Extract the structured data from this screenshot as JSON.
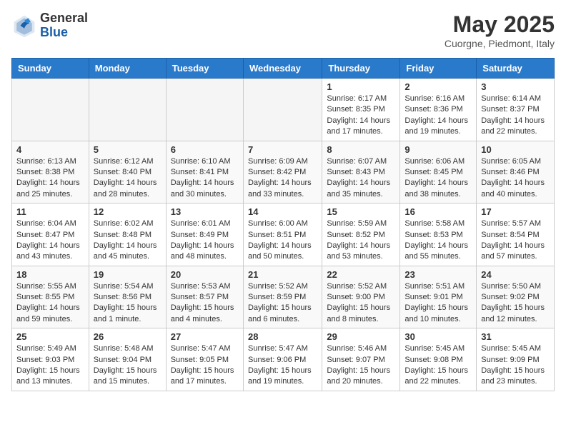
{
  "header": {
    "logo_general": "General",
    "logo_blue": "Blue",
    "month_title": "May 2025",
    "location": "Cuorgne, Piedmont, Italy"
  },
  "calendar": {
    "days_of_week": [
      "Sunday",
      "Monday",
      "Tuesday",
      "Wednesday",
      "Thursday",
      "Friday",
      "Saturday"
    ],
    "weeks": [
      [
        {
          "day": "",
          "empty": true
        },
        {
          "day": "",
          "empty": true
        },
        {
          "day": "",
          "empty": true
        },
        {
          "day": "",
          "empty": true
        },
        {
          "day": "1",
          "sunrise": "6:17 AM",
          "sunset": "8:35 PM",
          "daylight": "14 hours and 17 minutes."
        },
        {
          "day": "2",
          "sunrise": "6:16 AM",
          "sunset": "8:36 PM",
          "daylight": "14 hours and 19 minutes."
        },
        {
          "day": "3",
          "sunrise": "6:14 AM",
          "sunset": "8:37 PM",
          "daylight": "14 hours and 22 minutes."
        }
      ],
      [
        {
          "day": "4",
          "sunrise": "6:13 AM",
          "sunset": "8:38 PM",
          "daylight": "14 hours and 25 minutes."
        },
        {
          "day": "5",
          "sunrise": "6:12 AM",
          "sunset": "8:40 PM",
          "daylight": "14 hours and 28 minutes."
        },
        {
          "day": "6",
          "sunrise": "6:10 AM",
          "sunset": "8:41 PM",
          "daylight": "14 hours and 30 minutes."
        },
        {
          "day": "7",
          "sunrise": "6:09 AM",
          "sunset": "8:42 PM",
          "daylight": "14 hours and 33 minutes."
        },
        {
          "day": "8",
          "sunrise": "6:07 AM",
          "sunset": "8:43 PM",
          "daylight": "14 hours and 35 minutes."
        },
        {
          "day": "9",
          "sunrise": "6:06 AM",
          "sunset": "8:45 PM",
          "daylight": "14 hours and 38 minutes."
        },
        {
          "day": "10",
          "sunrise": "6:05 AM",
          "sunset": "8:46 PM",
          "daylight": "14 hours and 40 minutes."
        }
      ],
      [
        {
          "day": "11",
          "sunrise": "6:04 AM",
          "sunset": "8:47 PM",
          "daylight": "14 hours and 43 minutes."
        },
        {
          "day": "12",
          "sunrise": "6:02 AM",
          "sunset": "8:48 PM",
          "daylight": "14 hours and 45 minutes."
        },
        {
          "day": "13",
          "sunrise": "6:01 AM",
          "sunset": "8:49 PM",
          "daylight": "14 hours and 48 minutes."
        },
        {
          "day": "14",
          "sunrise": "6:00 AM",
          "sunset": "8:51 PM",
          "daylight": "14 hours and 50 minutes."
        },
        {
          "day": "15",
          "sunrise": "5:59 AM",
          "sunset": "8:52 PM",
          "daylight": "14 hours and 53 minutes."
        },
        {
          "day": "16",
          "sunrise": "5:58 AM",
          "sunset": "8:53 PM",
          "daylight": "14 hours and 55 minutes."
        },
        {
          "day": "17",
          "sunrise": "5:57 AM",
          "sunset": "8:54 PM",
          "daylight": "14 hours and 57 minutes."
        }
      ],
      [
        {
          "day": "18",
          "sunrise": "5:55 AM",
          "sunset": "8:55 PM",
          "daylight": "14 hours and 59 minutes."
        },
        {
          "day": "19",
          "sunrise": "5:54 AM",
          "sunset": "8:56 PM",
          "daylight": "15 hours and 1 minute."
        },
        {
          "day": "20",
          "sunrise": "5:53 AM",
          "sunset": "8:57 PM",
          "daylight": "15 hours and 4 minutes."
        },
        {
          "day": "21",
          "sunrise": "5:52 AM",
          "sunset": "8:59 PM",
          "daylight": "15 hours and 6 minutes."
        },
        {
          "day": "22",
          "sunrise": "5:52 AM",
          "sunset": "9:00 PM",
          "daylight": "15 hours and 8 minutes."
        },
        {
          "day": "23",
          "sunrise": "5:51 AM",
          "sunset": "9:01 PM",
          "daylight": "15 hours and 10 minutes."
        },
        {
          "day": "24",
          "sunrise": "5:50 AM",
          "sunset": "9:02 PM",
          "daylight": "15 hours and 12 minutes."
        }
      ],
      [
        {
          "day": "25",
          "sunrise": "5:49 AM",
          "sunset": "9:03 PM",
          "daylight": "15 hours and 13 minutes."
        },
        {
          "day": "26",
          "sunrise": "5:48 AM",
          "sunset": "9:04 PM",
          "daylight": "15 hours and 15 minutes."
        },
        {
          "day": "27",
          "sunrise": "5:47 AM",
          "sunset": "9:05 PM",
          "daylight": "15 hours and 17 minutes."
        },
        {
          "day": "28",
          "sunrise": "5:47 AM",
          "sunset": "9:06 PM",
          "daylight": "15 hours and 19 minutes."
        },
        {
          "day": "29",
          "sunrise": "5:46 AM",
          "sunset": "9:07 PM",
          "daylight": "15 hours and 20 minutes."
        },
        {
          "day": "30",
          "sunrise": "5:45 AM",
          "sunset": "9:08 PM",
          "daylight": "15 hours and 22 minutes."
        },
        {
          "day": "31",
          "sunrise": "5:45 AM",
          "sunset": "9:09 PM",
          "daylight": "15 hours and 23 minutes."
        }
      ]
    ]
  }
}
